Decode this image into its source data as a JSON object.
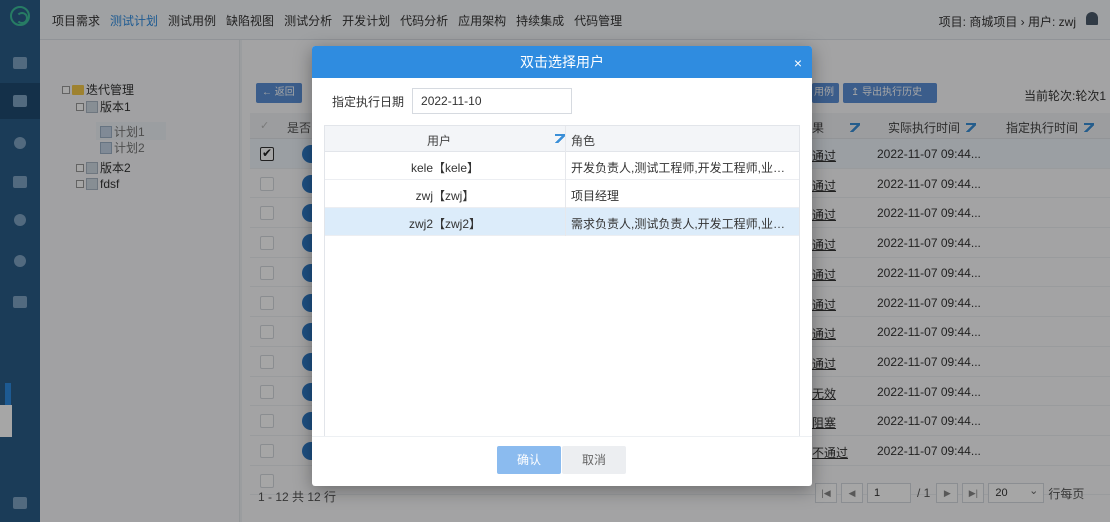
{
  "nav": {
    "items": [
      "项目需求",
      "测试计划",
      "测试用例",
      "缺陷视图",
      "测试分析",
      "开发计划",
      "代码分析",
      "应用架构",
      "持续集成",
      "代码管理"
    ],
    "active_index": 1,
    "project_info": "项目: 商城项目 › 用户: zwj"
  },
  "tree": {
    "root": "迭代管理",
    "v1": "版本1",
    "plan1": "计划1",
    "plan2": "计划2",
    "v2": "版本2",
    "other": "fdsf"
  },
  "toolbar": {
    "back_label": "← 返回",
    "export_label": "↥ 导出执行历史",
    "case_label": "用例",
    "round_label": "当前轮次:轮次1"
  },
  "table": {
    "header_left": "是否",
    "header_result": "果",
    "header_time": "实际执行时间",
    "header_assigned_time": "指定执行时间",
    "rows": [
      {
        "result": "通过",
        "time": "2022-11-07 09:44..."
      },
      {
        "result": "通过",
        "time": "2022-11-07 09:44..."
      },
      {
        "result": "通过",
        "time": "2022-11-07 09:44..."
      },
      {
        "result": "通过",
        "time": "2022-11-07 09:44..."
      },
      {
        "result": "通过",
        "time": "2022-11-07 09:44..."
      },
      {
        "result": "通过",
        "time": "2022-11-07 09:44..."
      },
      {
        "result": "通过",
        "time": "2022-11-07 09:44..."
      },
      {
        "result": "通过",
        "time": "2022-11-07 09:44..."
      },
      {
        "result": "无效",
        "time": "2022-11-07 09:44..."
      },
      {
        "result": "阻塞",
        "time": "2022-11-07 09:44..."
      },
      {
        "result": "不通过",
        "time": "2022-11-07 09:44..."
      }
    ]
  },
  "footer": {
    "summary": "1 - 12 共 12 行",
    "page_input": "1",
    "page_total": "/ 1",
    "page_size": "20",
    "page_size_label": "行每页"
  },
  "modal": {
    "title": "双击选择用户",
    "close": "×",
    "date_label": "指定执行日期",
    "date_value": "2022-11-10",
    "col_user": "用户",
    "col_role": "角色",
    "users": [
      {
        "user": "kele【kele】",
        "role": "开发负责人,测试工程师,开发工程师,业务负..."
      },
      {
        "user": "zwj【zwj】",
        "role": "项目经理"
      },
      {
        "user": "zwj2【zwj2】",
        "role": "需求负责人,测试负责人,开发工程师,业务负..."
      }
    ],
    "selected_index": 2,
    "ok_label": "确认",
    "cancel_label": "取消"
  },
  "colors": {
    "accent": "#2f8ce0",
    "rail": "#2a5c87"
  }
}
